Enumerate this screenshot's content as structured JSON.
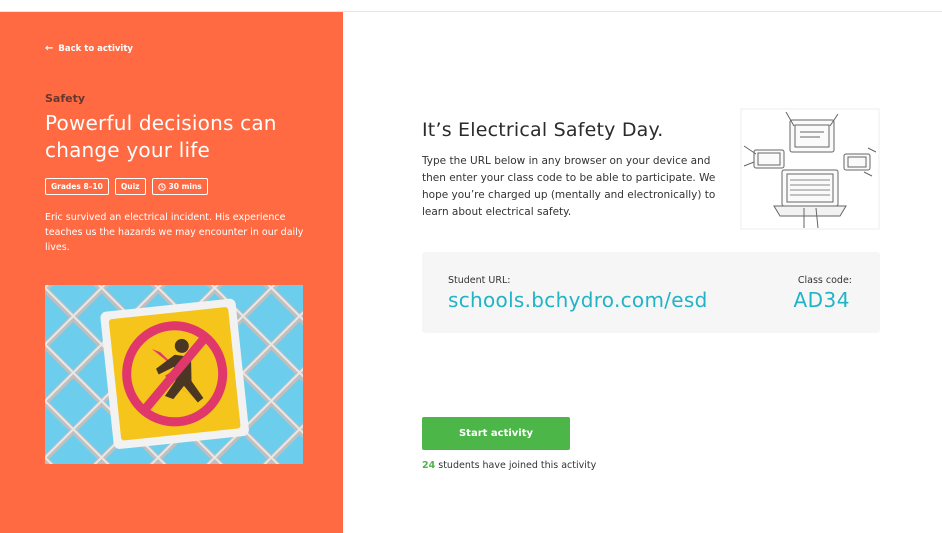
{
  "left_panel": {
    "back_label": "Back to activity",
    "subject": "Safety",
    "title": "Powerful decisions can change your life",
    "tags": {
      "grades": "Grades 8–10",
      "type": "Quiz",
      "duration": "30 mins"
    },
    "description": "Eric survived an electrical incident. His experience teaches us the hazards we may encounter in our daily lives.",
    "accent_color": "#ff6a42"
  },
  "main": {
    "title": "It’s Electrical Safety Day.",
    "body": "Type the URL below in any browser on your device and then enter your class code to be able to participate. We hope you’re charged up (mentally and electronically) to learn about electrical safety.",
    "student_url_label": "Student URL:",
    "student_url": "schools.bchydro.com/esd",
    "class_code_label": "Class code:",
    "class_code": "AD34",
    "start_button": "Start activity",
    "joined_count": "24",
    "joined_text": " students have joined this activity",
    "link_color": "#1fb4c6",
    "button_color": "#4cb648"
  },
  "icons": {
    "back": "arrow-left-icon",
    "clock": "clock-icon",
    "illustration": "devices-illustration",
    "hero": "electrical-hazard-sign"
  }
}
